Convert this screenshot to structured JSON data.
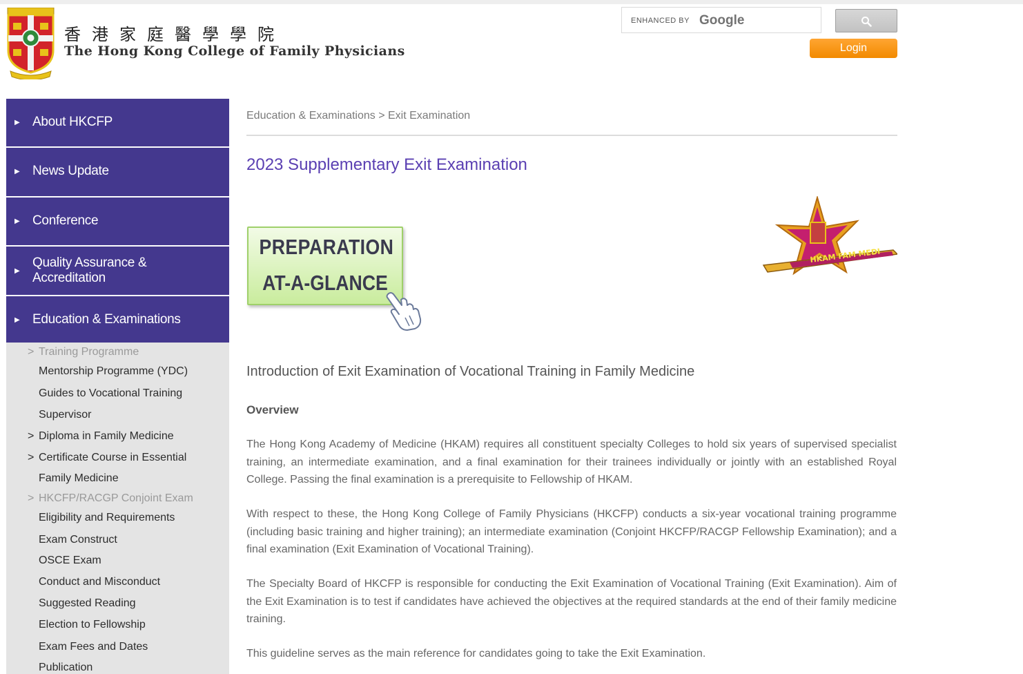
{
  "header": {
    "logo_cn": "香港家庭醫學學院",
    "logo_en": "The Hong Kong College of Family Physicians",
    "search_enhanced_by": "ENHANCED BY",
    "search_brand": "Google",
    "login_label": "Login"
  },
  "sidebar": {
    "items": [
      {
        "label": "About HKCFP"
      },
      {
        "label": "News Update"
      },
      {
        "label": "Conference"
      },
      {
        "label": "Quality Assurance & Accreditation"
      },
      {
        "label": "Education & Examinations"
      }
    ],
    "sub_items": [
      {
        "prefix": ">",
        "label": "Training Programme"
      },
      {
        "prefix": "",
        "label": "Mentorship Programme (YDC)"
      },
      {
        "prefix": "",
        "label": "Guides to Vocational Training"
      },
      {
        "prefix": "",
        "label": "Supervisor"
      },
      {
        "prefix": ">",
        "label": "Diploma in Family Medicine"
      },
      {
        "prefix": ">",
        "label": "Certificate Course in Essential"
      },
      {
        "prefix": "",
        "label": "Family Medicine"
      },
      {
        "prefix": ">",
        "label": "HKCFP/RACGP Conjoint Exam"
      },
      {
        "prefix": "",
        "label": "Eligibility and Requirements"
      },
      {
        "prefix": "",
        "label": "Exam Construct"
      },
      {
        "prefix": "",
        "label": "OSCE Exam"
      },
      {
        "prefix": "",
        "label": "Conduct and Misconduct"
      },
      {
        "prefix": "",
        "label": "Suggested Reading"
      },
      {
        "prefix": "",
        "label": "Election to Fellowship"
      },
      {
        "prefix": "",
        "label": "Exam Fees and Dates"
      },
      {
        "prefix": "",
        "label": "Publication"
      }
    ]
  },
  "main": {
    "breadcrumb": "Education & Examinations > Exit Examination",
    "title": "2023 Supplementary Exit Examination",
    "prep_line1": "PREPARATION",
    "prep_line2": "AT-A-GLANCE",
    "badge_text": "HKAM FAM MEDI",
    "intro_heading": "Introduction of Exit Examination of Vocational Training in Family Medicine",
    "overview_heading": "Overview",
    "paragraphs": [
      "The Hong Kong Academy of Medicine (HKAM) requires all constituent specialty Colleges to hold six years of supervised specialist training, an intermediate examination, and a final examination for their trainees individually or jointly with an established Royal College. Passing the final examination is a prerequisite to Fellowship of HKAM.",
      "With respect to these, the Hong Kong College of Family Physicians (HKCFP) conducts a six-year vocational training programme (including basic training and higher training); an intermediate examination (Conjoint HKCFP/RACGP Fellowship Examination); and a final examination (Exit Examination of Vocational Training).",
      "The Specialty Board of HKCFP is responsible for conducting the Exit Examination of Vocational Training (Exit Examination). Aim of the Exit Examination is to test if candidates have achieved the objectives at the required standards at the end of their family medicine training.",
      "This guideline serves as the main reference for candidates going to take the Exit Examination."
    ]
  },
  "colors": {
    "nav_bg": "#44388e",
    "title": "#5a3fb2",
    "login": "#f28a00",
    "subnav_bg": "#e4e4e4"
  }
}
